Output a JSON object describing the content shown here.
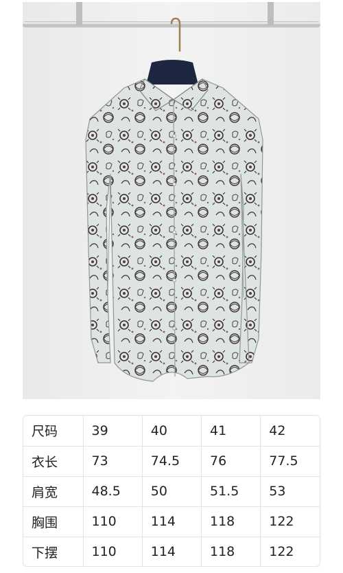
{
  "product_image": {
    "subject": "white long-sleeve shirt with black floral and cartoon animal print on hanger",
    "icon": "shirt-photo"
  },
  "size_table": {
    "rows": [
      {
        "label": "尺码",
        "values": [
          "39",
          "40",
          "41",
          "42"
        ]
      },
      {
        "label": "衣长",
        "values": [
          "73",
          "74.5",
          "76",
          "77.5"
        ]
      },
      {
        "label": "肩宽",
        "values": [
          "48.5",
          "50",
          "51.5",
          "53"
        ]
      },
      {
        "label": "胸围",
        "values": [
          "110",
          "114",
          "118",
          "122"
        ]
      },
      {
        "label": "下摆",
        "values": [
          "110",
          "114",
          "118",
          "122"
        ]
      }
    ]
  },
  "colors": {
    "shirt": "#dde4e2",
    "print": "#3b2f33",
    "hanger": "#1d2740",
    "rail": "#b9b9b9"
  }
}
